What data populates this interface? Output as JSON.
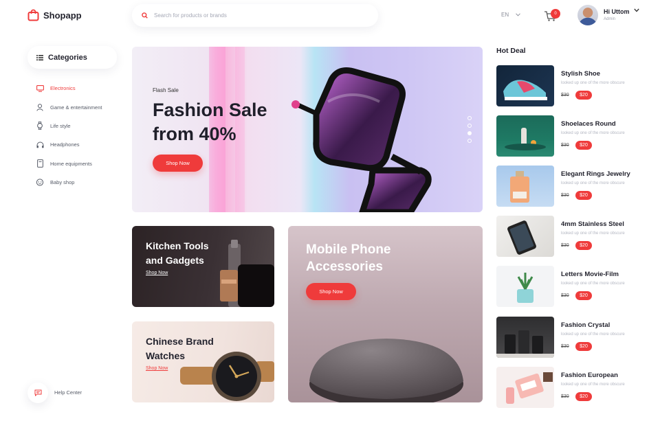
{
  "header": {
    "brand": "Shopapp",
    "search_placeholder": "Search for products or brands",
    "language": "EN",
    "cart_count": "0",
    "user_name": "Hi Uttom",
    "user_role": "Admin"
  },
  "sidebar": {
    "title": "Categories",
    "items": [
      {
        "label": "Electronics",
        "icon": "monitor-icon"
      },
      {
        "label": "Game & entertainment",
        "icon": "user-icon"
      },
      {
        "label": "Life style",
        "icon": "watch-icon"
      },
      {
        "label": "Headphones",
        "icon": "headphones-icon"
      },
      {
        "label": "Home equipments",
        "icon": "device-icon"
      },
      {
        "label": "Baby shop",
        "icon": "baby-icon"
      }
    ],
    "help": "Help Center"
  },
  "hero": {
    "subtitle": "Flash Sale",
    "title": "Fashion Sale from 40%",
    "button": "Shop Now"
  },
  "promos": {
    "kitchen": {
      "title": "Kitchen Tools and Gadgets",
      "link": "Shop Now"
    },
    "watches": {
      "title": "Chinese Brand Watches",
      "link": "Shop Now"
    },
    "mobile": {
      "title": "Mobile Phone Accessories",
      "button": "Shop Now"
    }
  },
  "hot_deal": {
    "title": "Hot Deal",
    "items": [
      {
        "name": "Stylish Shoe",
        "desc": "looked up one of the more obscure",
        "old": "$30",
        "new": "$20"
      },
      {
        "name": "Shoelaces Round",
        "desc": "looked up one of the more obscure",
        "old": "$30",
        "new": "$20"
      },
      {
        "name": "Elegant Rings Jewelry",
        "desc": "looked up one of the more obscure",
        "old": "$30",
        "new": "$20"
      },
      {
        "name": "4mm Stainless Steel",
        "desc": "looked up one of the more obscure",
        "old": "$30",
        "new": "$20"
      },
      {
        "name": "Letters Movie-Film",
        "desc": "looked up one of the more obscure",
        "old": "$30",
        "new": "$20"
      },
      {
        "name": "Fashion Crystal",
        "desc": "looked up one of the more obscure",
        "old": "$30",
        "new": "$20"
      },
      {
        "name": "Fashion European",
        "desc": "looked up one of the more obscure",
        "old": "$30",
        "new": "$20"
      }
    ]
  },
  "colors": {
    "accent": "#ef3b3b",
    "text": "#23232e",
    "muted": "#a5a8b5"
  }
}
